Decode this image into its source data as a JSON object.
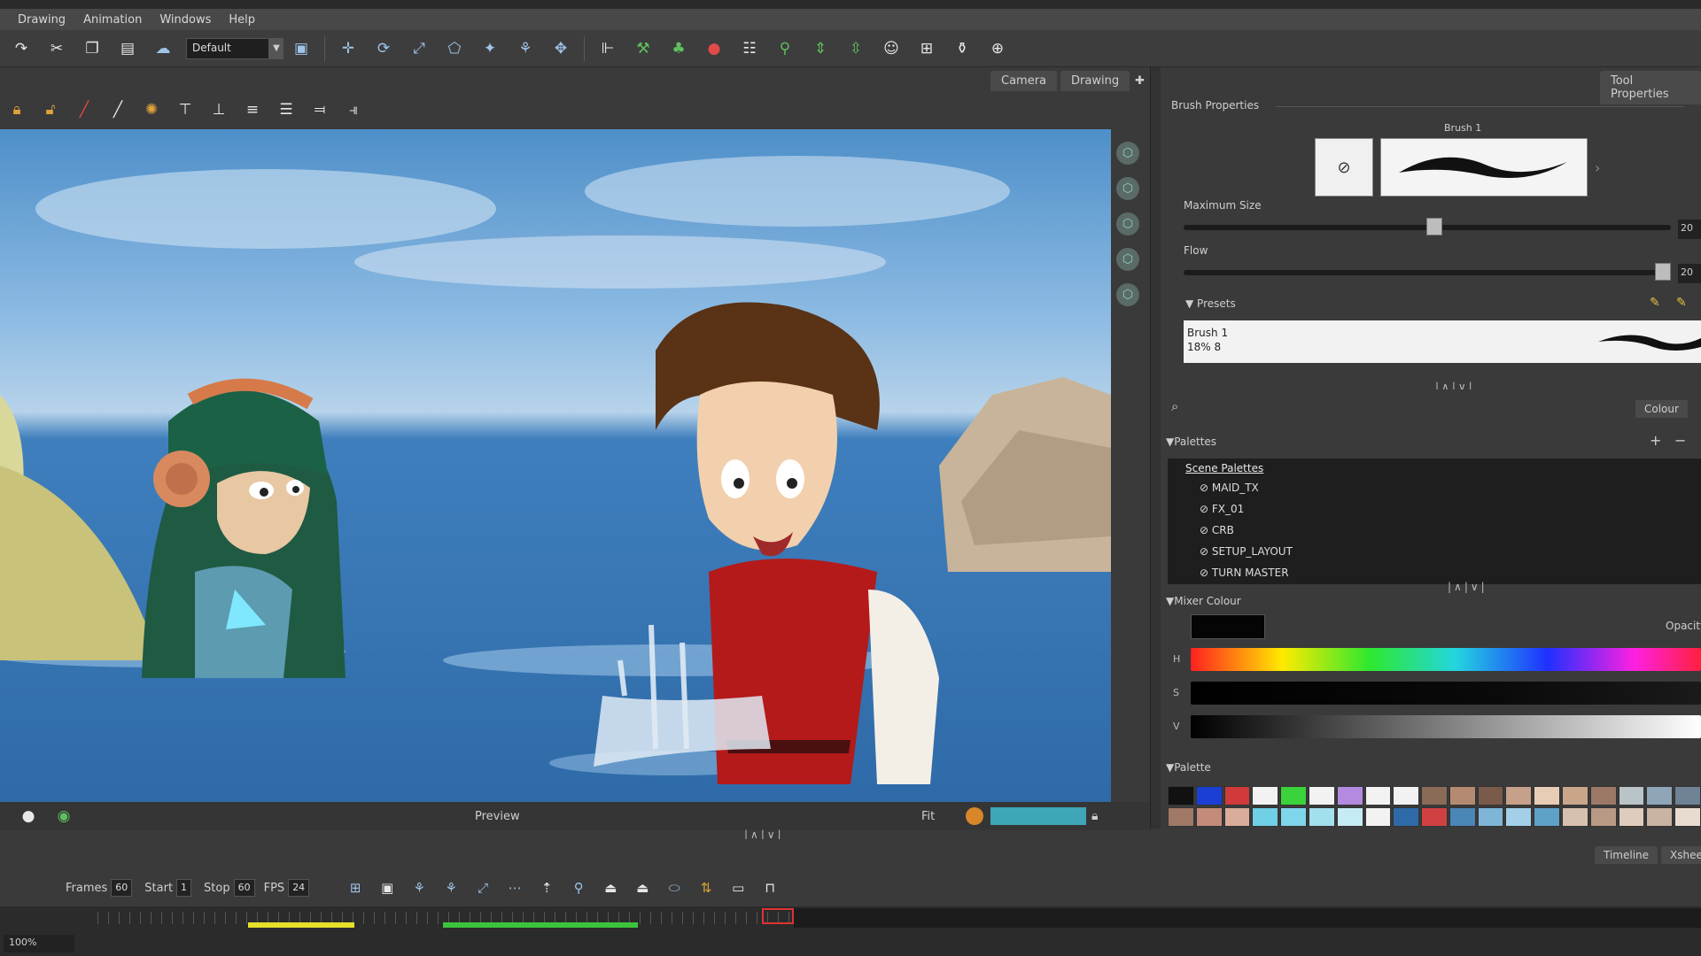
{
  "menu": [
    "Drawing",
    "Animation",
    "Windows",
    "Help"
  ],
  "toolbar": {
    "preset_value": "Default"
  },
  "camera": {
    "tabs": [
      "Camera",
      "Drawing"
    ]
  },
  "viewport": {
    "status_label": "Preview",
    "fit_label": "Fit"
  },
  "tool_properties": {
    "tab": "Tool Properties",
    "section_title": "Brush Properties",
    "brush_name": "Brush 1",
    "max_size_label": "Maximum Size",
    "flow_label": "Flow",
    "max_size_value": "20",
    "flow_value": "20",
    "presets_label": "Presets",
    "preset_entry": {
      "name": "Brush 1",
      "detail": "18% 8"
    }
  },
  "colour": {
    "tab": "Colour",
    "palettes_label": "Palettes",
    "palette_list": {
      "header": "Scene Palettes",
      "items": [
        "MAID_TX",
        "FX_01",
        "CRB",
        "SETUP_LAYOUT",
        "TURN MASTER"
      ]
    },
    "mixer_label": "Mixer Colour",
    "opacity_label": "Opacity",
    "bar_labels": [
      "H",
      "S",
      "V"
    ],
    "palette_label": "Palette",
    "swatch_colors": [
      "#111111",
      "#1b3fd4",
      "#d03a3a",
      "#f2f2f2",
      "#3bd33b",
      "#f2f2f2",
      "#b38ae0",
      "#f2f2f2",
      "#f2f2f2",
      "#8a6b58",
      "#b58a72",
      "#7a5a4a",
      "#c6a088",
      "#e8cdb6",
      "#c9a58a",
      "#9c7866",
      "#b8c4c8",
      "#8fa6b8",
      "#6f8296",
      "#a07866",
      "#c48b7a",
      "#d9ad9a",
      "#6fd0e6",
      "#7fd6ea",
      "#a3e0ee",
      "#c5ecf4",
      "#f2f2f2",
      "#2f6aa8",
      "#d04242",
      "#4a86b6",
      "#7fb6d8",
      "#a3d0e8",
      "#5fa2c8",
      "#d8c0ae",
      "#b89a84",
      "#e0ccbc",
      "#c9b3a2",
      "#e8dcd0"
    ]
  },
  "timeline": {
    "tabs": [
      "Timeline",
      "Xsheet"
    ],
    "frames_label": "Frames",
    "frames_value": "60",
    "start_label": "Start",
    "start_value": "1",
    "stop_label": "Stop",
    "stop_value": "60",
    "fps_label": "FPS",
    "fps_value": "24",
    "zoom_value": "100%"
  }
}
